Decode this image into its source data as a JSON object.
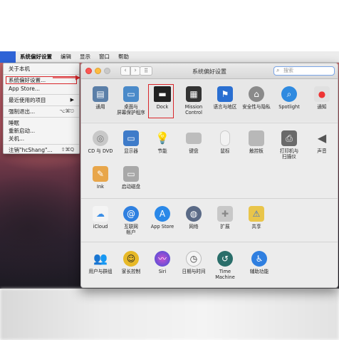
{
  "menubar": {
    "app_name": "系统偏好设置",
    "items": [
      "编辑",
      "显示",
      "窗口",
      "帮助"
    ]
  },
  "apple_menu": {
    "about": "关于本机",
    "system_prefs": "系统偏好设置...",
    "app_store": "App Store...",
    "recent_items": "最近使用的项目",
    "force_quit": "强制退出...",
    "force_quit_shortcut": "⌥⌘⎋",
    "sleep": "睡眠",
    "restart": "重新启动...",
    "shutdown": "关机...",
    "logout": "注销\"hcShang\"...",
    "logout_shortcut": "⇧⌘Q"
  },
  "window": {
    "title": "系统偏好设置",
    "search_placeholder": "搜索"
  },
  "prefs": {
    "general": "通用",
    "desktop": "桌面与\n屏幕保护程序",
    "dock": "Dock",
    "mission": "Mission\nControl",
    "language": "语言与地区",
    "security": "安全性与隐私",
    "spotlight": "Spotlight",
    "notifications": "通知",
    "cd_dvd": "CD 与 DVD",
    "displays": "显示器",
    "energy": "节能",
    "keyboard": "键盘",
    "mouse": "鼠标",
    "trackpad": "触控板",
    "printers": "打印机与\n扫描仪",
    "sound": "声音",
    "ink": "Ink",
    "startup": "启动磁盘",
    "icloud": "iCloud",
    "internet": "互联网\n帐户",
    "appstore": "App Store",
    "network": "网络",
    "extensions": "扩展",
    "sharing": "共享",
    "users": "用户与群组",
    "parental": "家长控制",
    "siri": "Siri",
    "datetime": "日期与时间",
    "timemachine": "Time Machine",
    "accessibility": "辅助功能"
  },
  "colors": {
    "highlight_red": "#d9262a",
    "apple_blue": "#2e63d6"
  }
}
